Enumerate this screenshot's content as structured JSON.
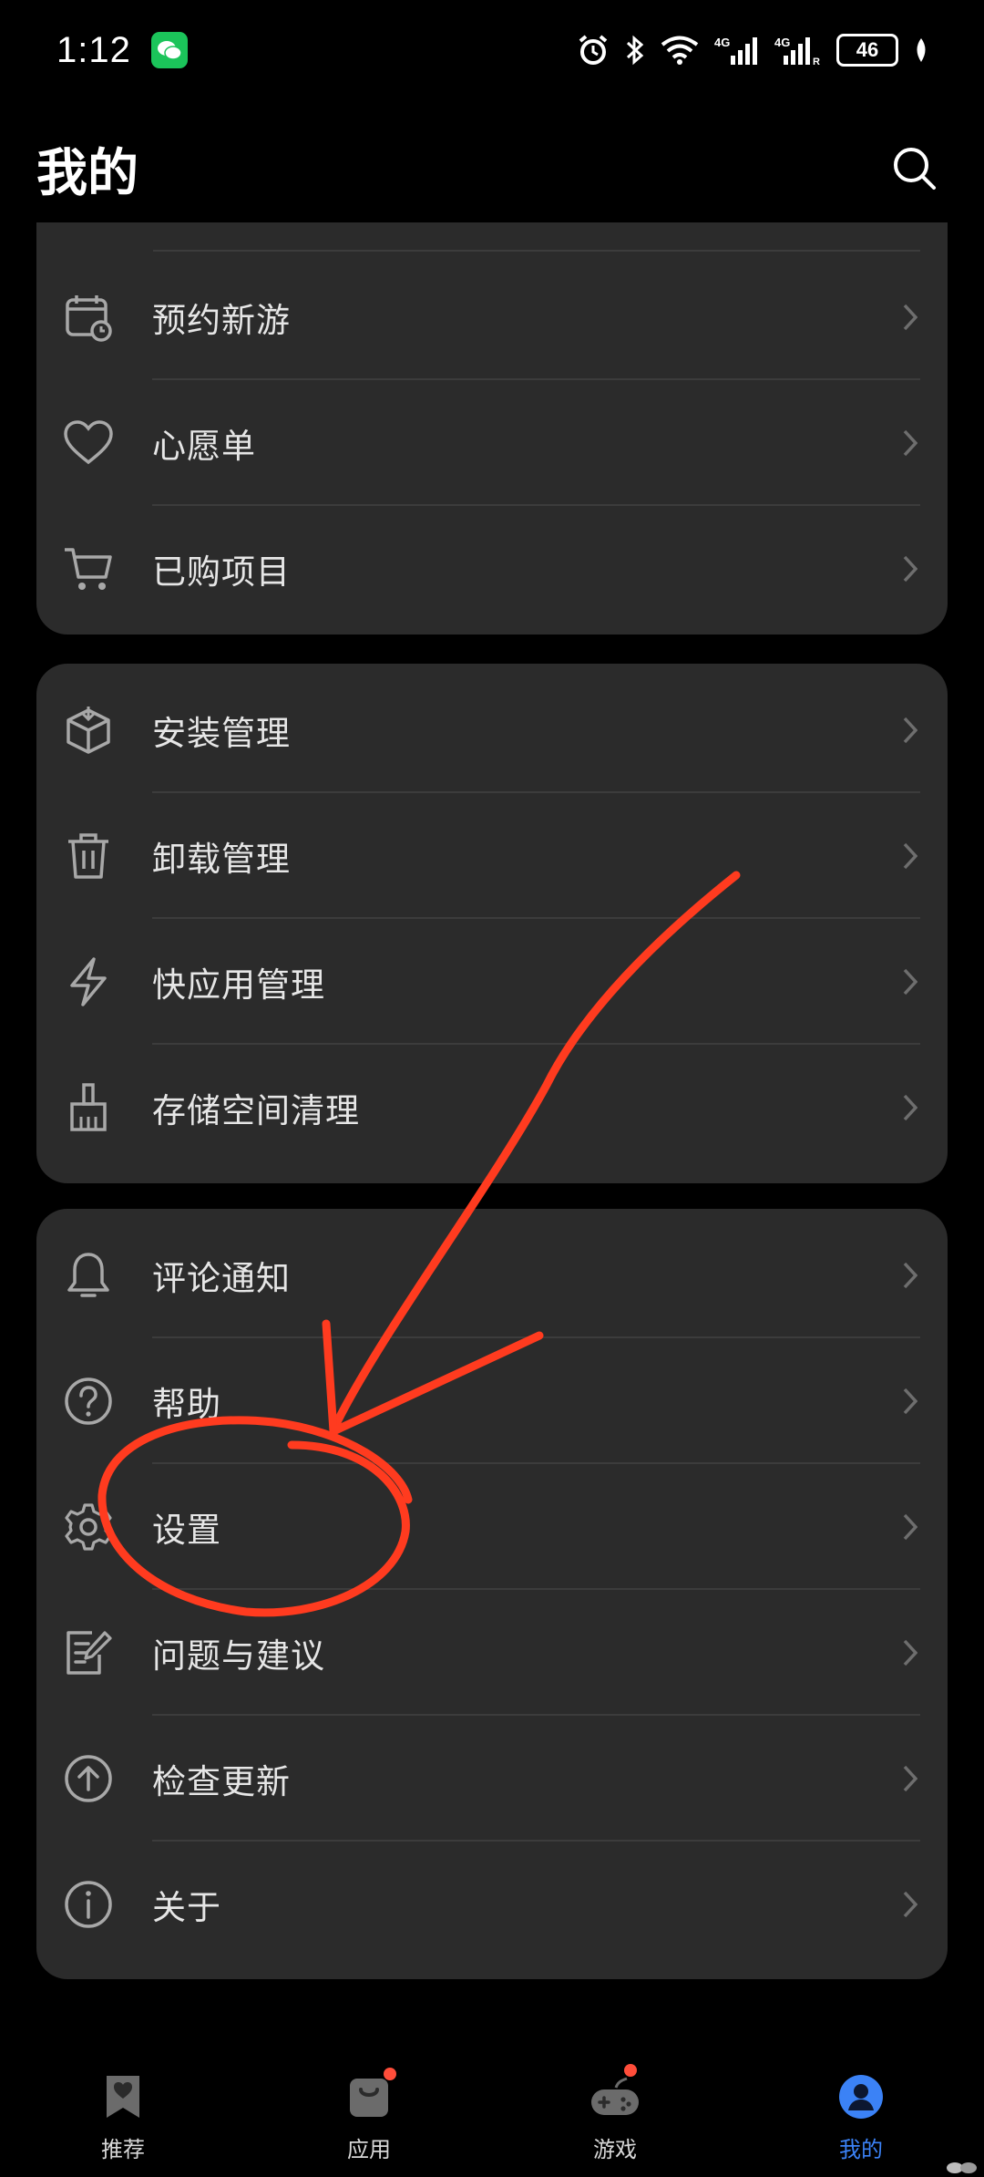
{
  "status_bar": {
    "time": "1:12",
    "battery": "46",
    "icons": [
      "wechat-icon",
      "alarm-icon",
      "bluetooth-icon",
      "wifi-icon",
      "signal-4g-icon",
      "signal-4g-r-icon",
      "battery-icon",
      "leaf-icon"
    ]
  },
  "header": {
    "title": "我的"
  },
  "group1": {
    "items": [
      {
        "label": "预约新游",
        "icon": "calendar-clock-icon"
      },
      {
        "label": "心愿单",
        "icon": "heart-icon"
      },
      {
        "label": "已购项目",
        "icon": "cart-icon"
      }
    ]
  },
  "group2": {
    "items": [
      {
        "label": "安装管理",
        "icon": "package-icon"
      },
      {
        "label": "卸载管理",
        "icon": "trash-icon"
      },
      {
        "label": "快应用管理",
        "icon": "lightning-icon"
      },
      {
        "label": "存储空间清理",
        "icon": "broom-icon"
      }
    ]
  },
  "group3": {
    "items": [
      {
        "label": "评论通知",
        "icon": "bell-icon"
      },
      {
        "label": "帮助",
        "icon": "help-icon"
      },
      {
        "label": "设置",
        "icon": "gear-icon"
      },
      {
        "label": "问题与建议",
        "icon": "feedback-icon"
      },
      {
        "label": "检查更新",
        "icon": "arrow-up-circle-icon"
      },
      {
        "label": "关于",
        "icon": "info-icon"
      }
    ]
  },
  "bottom_nav": {
    "items": [
      {
        "label": "推荐",
        "icon": "bookmark-heart-icon",
        "active": false
      },
      {
        "label": "应用",
        "icon": "shopping-bag-icon",
        "active": false,
        "badge": true
      },
      {
        "label": "游戏",
        "icon": "gamepad-icon",
        "active": false,
        "badge": true
      },
      {
        "label": "我的",
        "icon": "person-icon",
        "active": true
      }
    ]
  },
  "colors": {
    "background": "#000000",
    "card": "#2b2b2b",
    "accent": "#3b82f6",
    "annotation": "#ff3b1f",
    "badge": "#ff4d3a"
  }
}
